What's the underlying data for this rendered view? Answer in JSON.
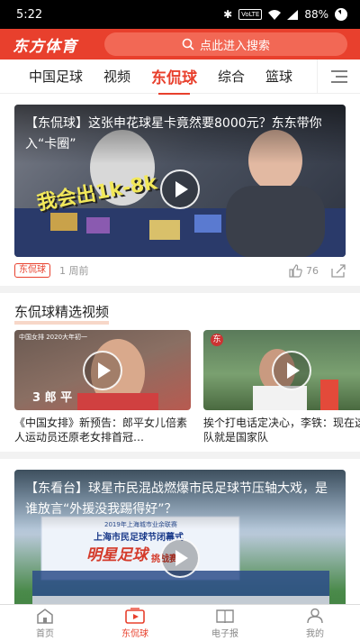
{
  "status_bar": {
    "time": "5:22",
    "volte": "VoLTE",
    "battery": "88%"
  },
  "header": {
    "logo": "东方体育",
    "search_placeholder": "点此进入搜索"
  },
  "tabs": [
    {
      "label": "中国足球",
      "active": false
    },
    {
      "label": "视频",
      "active": false
    },
    {
      "label": "东侃球",
      "active": true
    },
    {
      "label": "综合",
      "active": false
    },
    {
      "label": "篮球",
      "active": false
    }
  ],
  "feed": {
    "article1": {
      "title": "【东侃球】这张申花球星卡竟然要8000元？东东带你入“卡圈”",
      "overlay_text": "我会出1k-8k",
      "tag": "东侃球",
      "time": "1 周前",
      "likes": "76"
    },
    "section": {
      "title": "东侃球精选视频",
      "videos": [
        {
          "title": "《中国女排》新预告：郎平女儿倍素人运动员还原老女排首冠…",
          "caption_top": "中国女排 2020大年初一",
          "caption_name": "3 郎 平"
        },
        {
          "title": "挨个打电话定决心，李铁：现在这个队就是国家队",
          "caption_top": "东"
        }
      ]
    },
    "article2": {
      "title": "【东看台】球星市民混战燃爆市民足球节压轴大戏，是谁放言“外援没我踢得好”？",
      "banner_small": "2019年上海城市业余联赛",
      "banner_mid": "上海市民足球节闭幕式",
      "banner_big": "明星足球",
      "banner_tail": "挑战赛"
    }
  },
  "bottom_nav": [
    {
      "label": "首页",
      "icon": "home-icon",
      "active": false
    },
    {
      "label": "东侃球",
      "icon": "video-icon",
      "active": true
    },
    {
      "label": "电子报",
      "icon": "newspaper-icon",
      "active": false
    },
    {
      "label": "我的",
      "icon": "profile-icon",
      "active": false
    }
  ],
  "colors": {
    "brand": "#e8402d",
    "tab_active": "#e8402d"
  }
}
